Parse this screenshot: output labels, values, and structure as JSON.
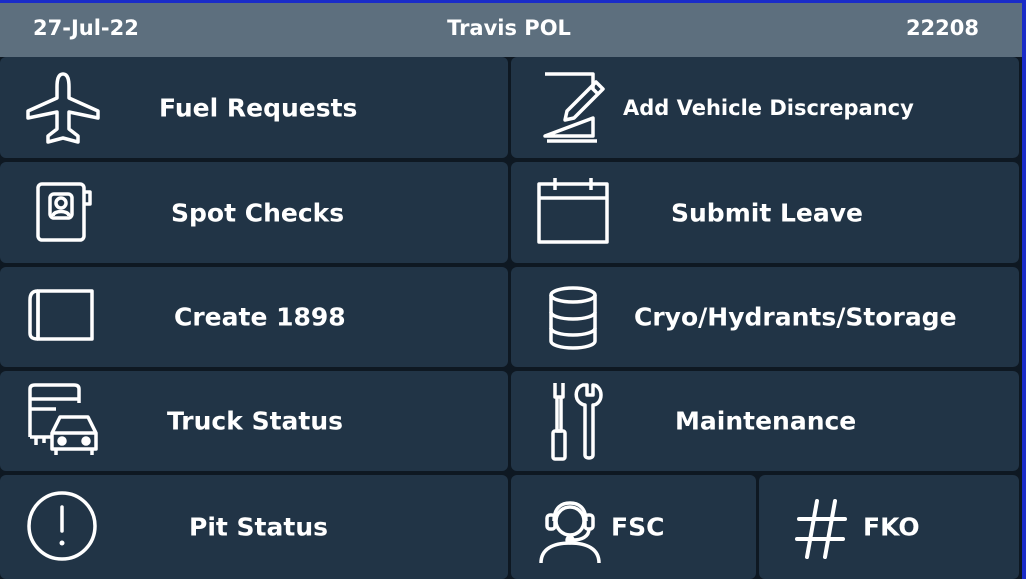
{
  "header": {
    "date": "27-Jul-22",
    "title": "Travis POL",
    "code": "22208"
  },
  "tiles": [
    {
      "label": "Fuel Requests",
      "icon": "airplane-icon"
    },
    {
      "label": "Add Vehicle Discrepancy",
      "icon": "edit-document-icon"
    },
    {
      "label": "Spot Checks",
      "icon": "contact-book-icon"
    },
    {
      "label": "Submit Leave",
      "icon": "calendar-icon"
    },
    {
      "label": "Create 1898",
      "icon": "blank-form-icon"
    },
    {
      "label": "Cryo/Hydrants/Storage",
      "icon": "database-icon"
    },
    {
      "label": "Truck Status",
      "icon": "bus-car-icon"
    },
    {
      "label": "Maintenance",
      "icon": "tools-icon"
    },
    {
      "label": "Pit Status",
      "icon": "alert-circle-icon"
    },
    {
      "label": "FSC",
      "icon": "headset-icon"
    },
    {
      "label": "FKO",
      "icon": "hash-icon"
    }
  ],
  "colors": {
    "header_bg": "#5d6f7e",
    "tile_bg": "#213446",
    "page_bg": "#0e1822",
    "accent_line": "#1a2cc8"
  }
}
